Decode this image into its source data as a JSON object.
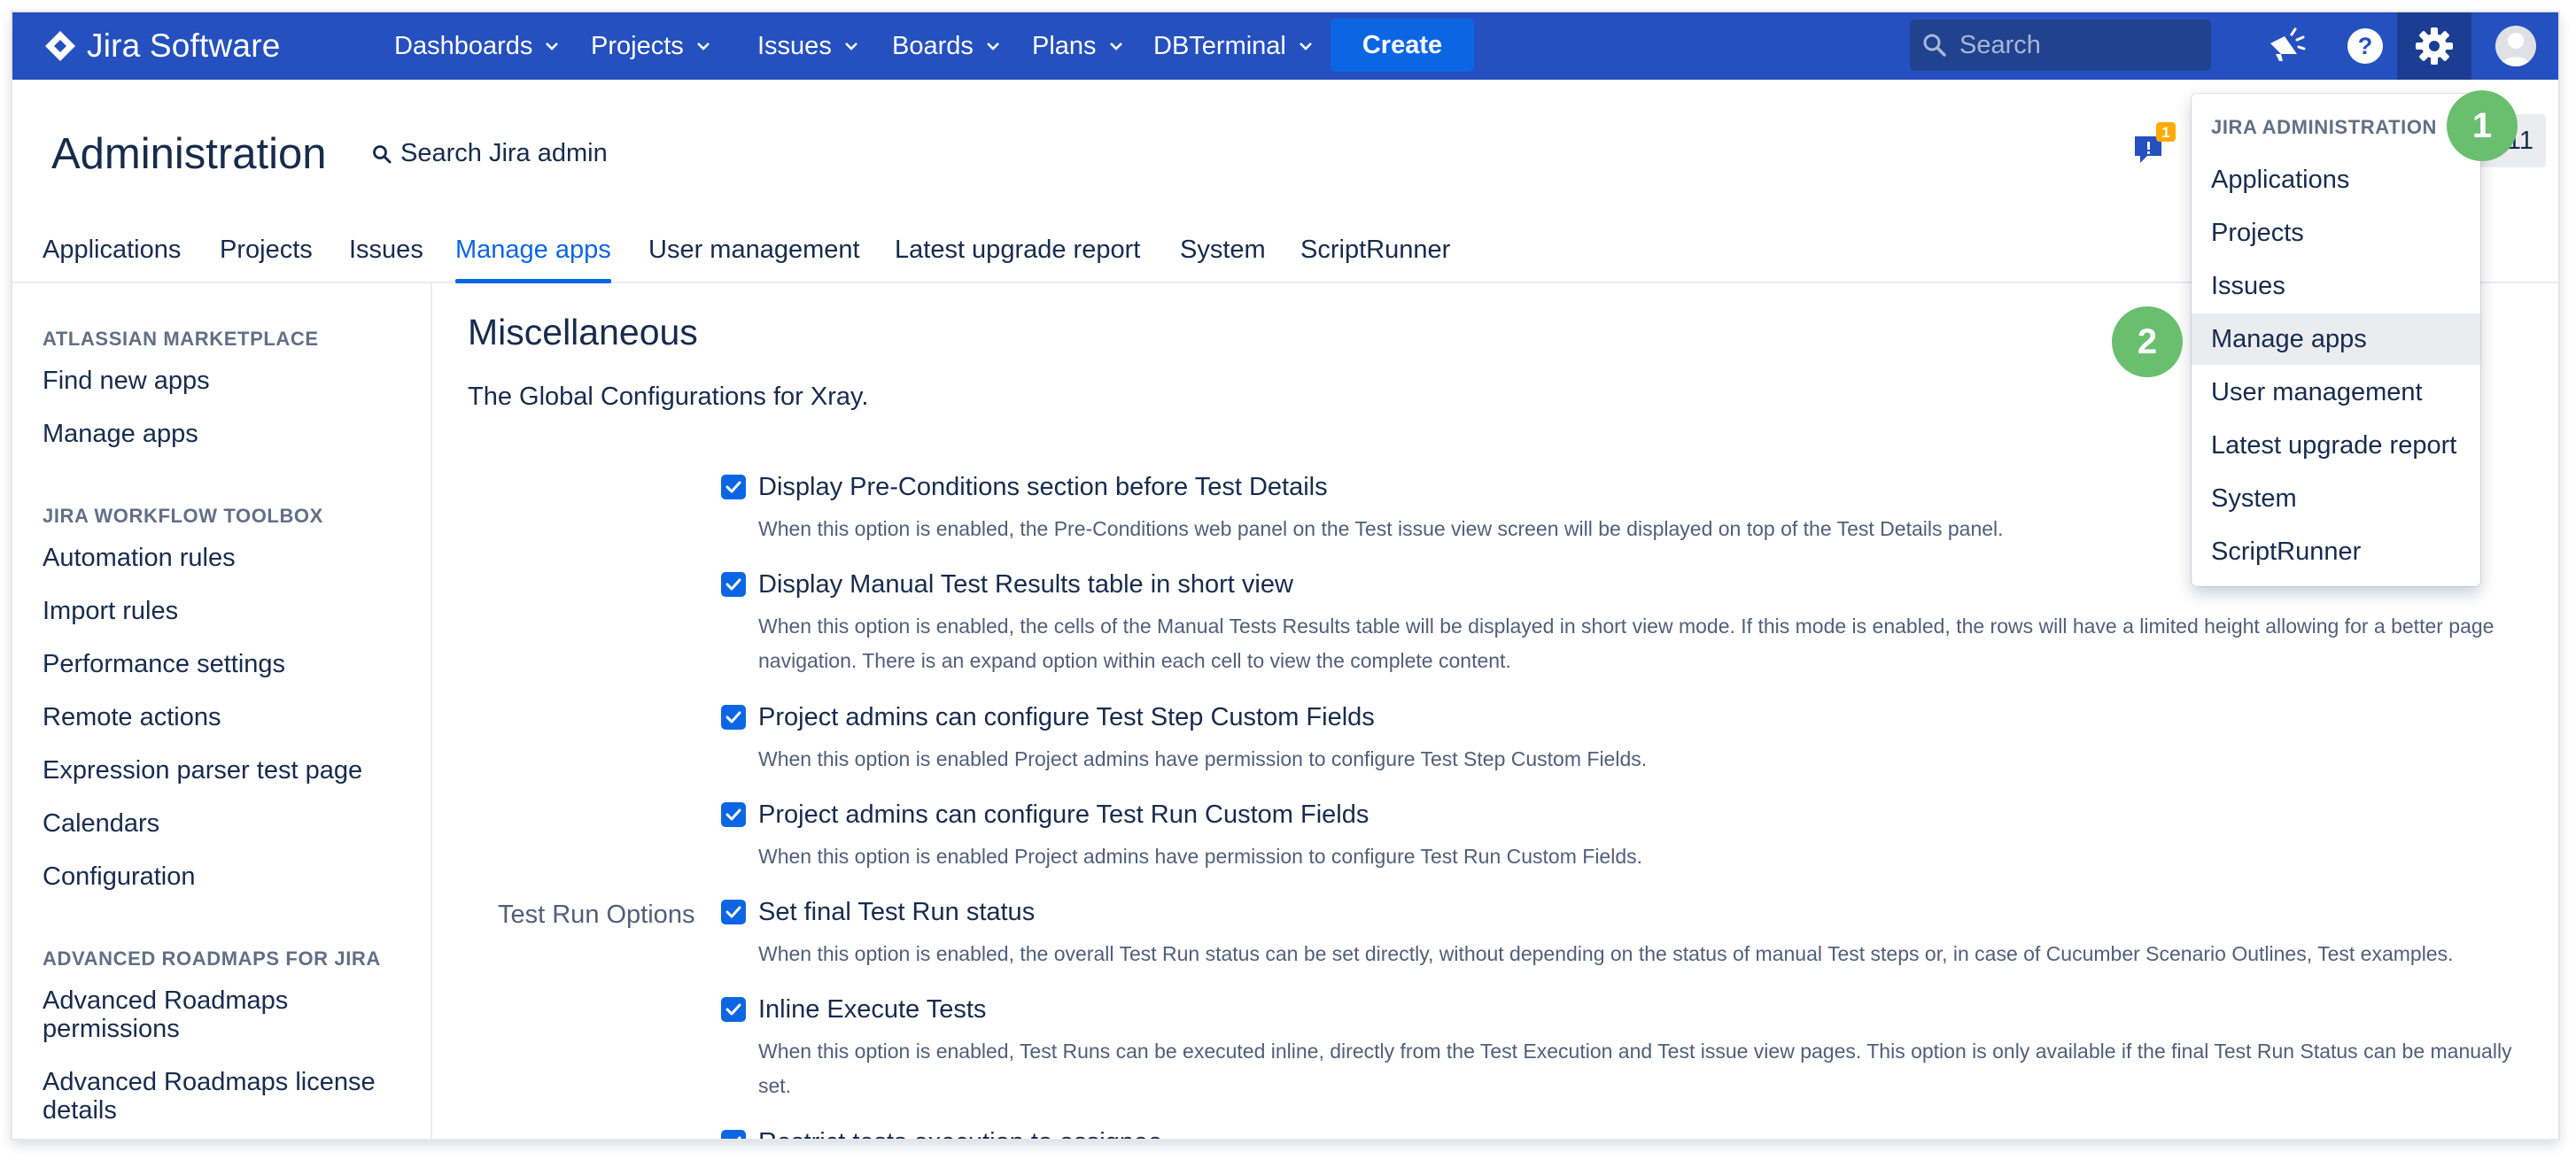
{
  "topnav": {
    "brand": "Jira Software",
    "menus": [
      "Dashboards",
      "Projects",
      "Issues",
      "Boards",
      "Plans",
      "DBTerminal"
    ],
    "create_label": "Create",
    "search_placeholder": "Search",
    "icons": [
      "megaphone-icon",
      "help-icon",
      "gear-icon",
      "avatar"
    ]
  },
  "admin": {
    "title": "Administration",
    "search_label": "Search Jira admin",
    "notification_count": "1"
  },
  "tabs": [
    "Applications",
    "Projects",
    "Issues",
    "Manage apps",
    "User management",
    "Latest upgrade report",
    "System",
    "ScriptRunner"
  ],
  "active_tab": "Manage apps",
  "sidebar": {
    "sections": [
      {
        "heading": "ATLASSIAN MARKETPLACE",
        "items": [
          "Find new apps",
          "Manage apps"
        ]
      },
      {
        "heading": "JIRA WORKFLOW TOOLBOX",
        "items": [
          "Automation rules",
          "Import rules",
          "Performance settings",
          "Remote actions",
          "Expression parser test page",
          "Calendars",
          "Configuration"
        ]
      },
      {
        "heading": "ADVANCED ROADMAPS FOR JIRA",
        "items": [
          "Advanced Roadmaps permissions",
          "Advanced Roadmaps license details"
        ]
      }
    ]
  },
  "main": {
    "title": "Miscellaneous",
    "subtitle": "The Global Configurations for Xray.",
    "group_label": "Test Run Options",
    "options": [
      {
        "checked": true,
        "title": "Display Pre-Conditions section before Test Details",
        "desc": "When this option is enabled, the Pre-Conditions web panel on the Test issue view screen will be displayed on top of the Test Details panel."
      },
      {
        "checked": true,
        "title": "Display Manual Test Results table in short view",
        "desc": "When this option is enabled, the cells of the Manual Tests Results table will be displayed in short view mode. If this mode is enabled, the rows will have a limited height allowing for a better page navigation. There is an expand option within each cell to view the complete content."
      },
      {
        "checked": true,
        "title": "Project admins can configure Test Step Custom Fields",
        "desc": "When this option is enabled Project admins have permission to configure Test Step Custom Fields."
      },
      {
        "checked": true,
        "title": "Project admins can configure Test Run Custom Fields",
        "desc": "When this option is enabled Project admins have permission to configure Test Run Custom Fields."
      },
      {
        "checked": true,
        "title": "Set final Test Run status",
        "desc": "When this option is enabled, the overall Test Run status can be set directly, without depending on the status of manual Test steps or, in case of Cucumber Scenario Outlines, Test examples."
      },
      {
        "checked": true,
        "title": "Inline Execute Tests",
        "desc": "When this option is enabled, Test Runs can be executed inline, directly from the Test Execution and Test issue view pages. This option is only available if the final Test Run Status can be manually set."
      },
      {
        "checked": true,
        "title": "Restrict tests execution to assignee",
        "desc": ""
      }
    ]
  },
  "dropdown": {
    "heading": "JIRA ADMINISTRATION",
    "items": [
      "Applications",
      "Projects",
      "Issues",
      "Manage apps",
      "User management",
      "Latest upgrade report",
      "System",
      "ScriptRunner"
    ],
    "active_item": "Manage apps"
  },
  "markers": [
    "1",
    "2"
  ],
  "colors": {
    "nav_bg": "#2550bf",
    "accent": "#0c66e4",
    "marker": "#6abf6f"
  }
}
